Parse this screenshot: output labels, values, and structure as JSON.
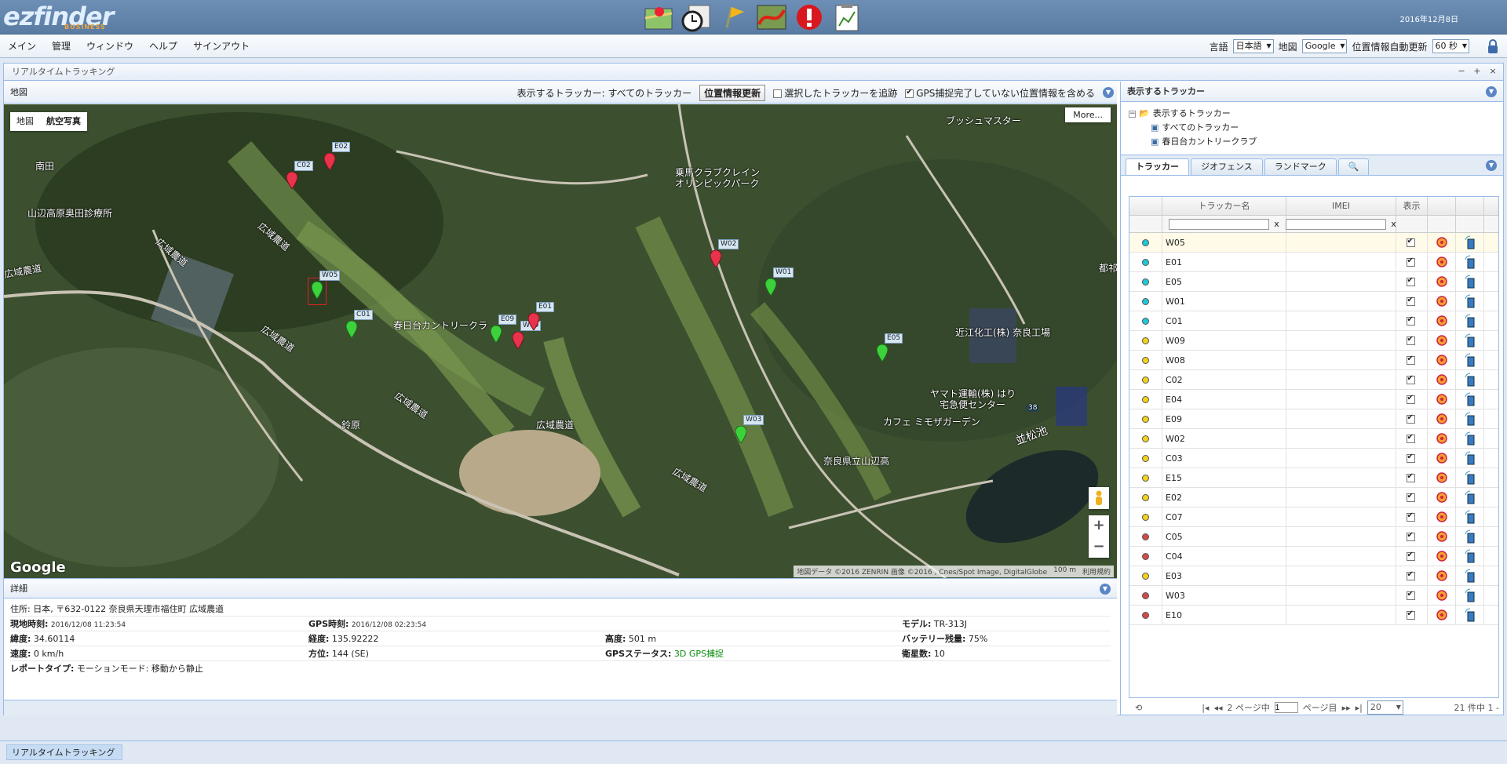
{
  "header": {
    "logo": "ezfinder",
    "logo_sub": "BUSINESS",
    "date": "2016年12月8日",
    "icons": [
      "map-tracking-icon",
      "history-clock-icon",
      "geofence-flag-icon",
      "route-icon",
      "alert-icon",
      "report-chart-icon"
    ]
  },
  "menu": {
    "items": [
      "メイン",
      "管理",
      "ウィンドウ",
      "ヘルプ",
      "サインアウト"
    ],
    "lang_label": "言語",
    "lang_value": "日本語",
    "map_label": "地図",
    "map_value": "Google",
    "refresh_label": "位置情報自動更新",
    "refresh_value": "60 秒"
  },
  "window": {
    "title": "リアルタイムトラッキング"
  },
  "map": {
    "header_title": "地図",
    "tracker_filter": "表示するトラッカー: すべてのトラッカー",
    "refresh_button": "位置情報更新",
    "follow_label": "選択したトラッカーを追跡",
    "gps_label": "GPS捕捉完了していない位置情報を含める",
    "maptype": [
      "地図",
      "航空写真"
    ],
    "more": "More...",
    "google": "Google",
    "attribution": "地図データ ©2016 ZENRIN 画像 ©2016 , Cnes/Spot Image, DigitalGlobe",
    "scale": "100 m",
    "terms": "利用規約",
    "labels": [
      "ブッシュマスター",
      "南田",
      "山辺高原奥田診療所",
      "広域農道",
      "乗馬クラブクレイン",
      "オリンピックパーク",
      "都祁",
      "春日台カントリークラ",
      "近江化工(株) 奈良工場",
      "ヤマト運輸(株) はり",
      "宅急便センター",
      "カフェ ミモザガーデン",
      "並松池",
      "奈良県立山辺高",
      "鈴原",
      "広域農道",
      "広域農道",
      "広域農道",
      "広域農道",
      "広域農道",
      "広域農道",
      "38"
    ],
    "markers": [
      "E02",
      "C02",
      "W05",
      "C01",
      "E09",
      "W09",
      "E01",
      "W02",
      "W01",
      "E05",
      "W03"
    ]
  },
  "detail": {
    "title": "詳細",
    "address": "住所: 日本, 〒632-0122 奈良県天理市福住町 広域農道",
    "local_time_label": "現地時刻:",
    "local_time": "2016/12/08 11:23:54",
    "gps_time_label": "GPS時刻:",
    "gps_time": "2016/12/08 02:23:54",
    "model_label": "モデル:",
    "model": "TR-313J",
    "lat_label": "緯度:",
    "lat": "34.60114",
    "lng_label": "経度:",
    "lng": "135.92222",
    "alt_label": "高度:",
    "alt": "501 m",
    "battery_label": "バッテリー残量:",
    "battery": "75%",
    "speed_label": "速度:",
    "speed": "0 km/h",
    "dir_label": "方位:",
    "dir": "144 (SE)",
    "gps_status_label": "GPSステータス:",
    "gps_status": "3D GPS捕捉",
    "sat_label": "衛星数:",
    "sat": "10",
    "report_label": "レポートタイプ:",
    "report": "モーションモード: 移動から静止"
  },
  "right": {
    "title": "表示するトラッカー",
    "tree": [
      "表示するトラッカー",
      "すべてのトラッカー",
      "春日台カントリークラブ"
    ],
    "tabs": [
      "トラッカー",
      "ジオフェンス",
      "ランドマーク"
    ],
    "cols": [
      "トラッカー名",
      "IMEI",
      "表示"
    ],
    "filter_clear": "x",
    "rows": [
      {
        "name": "W05",
        "color": "#1ec8d8"
      },
      {
        "name": "E01",
        "color": "#1ec8d8"
      },
      {
        "name": "E05",
        "color": "#1ec8d8"
      },
      {
        "name": "W01",
        "color": "#1ec8d8"
      },
      {
        "name": "C01",
        "color": "#1ec8d8"
      },
      {
        "name": "W09",
        "color": "#f2d21a"
      },
      {
        "name": "W08",
        "color": "#f2d21a"
      },
      {
        "name": "C02",
        "color": "#f2d21a"
      },
      {
        "name": "E04",
        "color": "#f2d21a"
      },
      {
        "name": "E09",
        "color": "#f2d21a"
      },
      {
        "name": "W02",
        "color": "#f2d21a"
      },
      {
        "name": "C03",
        "color": "#f2d21a"
      },
      {
        "name": "E15",
        "color": "#f2d21a"
      },
      {
        "name": "E02",
        "color": "#f2d21a"
      },
      {
        "name": "C07",
        "color": "#f2d21a"
      },
      {
        "name": "C05",
        "color": "#d24a4a"
      },
      {
        "name": "C04",
        "color": "#d24a4a"
      },
      {
        "name": "E03",
        "color": "#f2d21a"
      },
      {
        "name": "W03",
        "color": "#d24a4a"
      },
      {
        "name": "E10",
        "color": "#d24a4a"
      }
    ],
    "pager": {
      "page_of": "2 ページ中",
      "page": "1",
      "page_suffix": "ページ目",
      "size": "20",
      "count": "21 件中 1 -"
    }
  },
  "taskbar": {
    "task": "リアルタイムトラッキング"
  }
}
